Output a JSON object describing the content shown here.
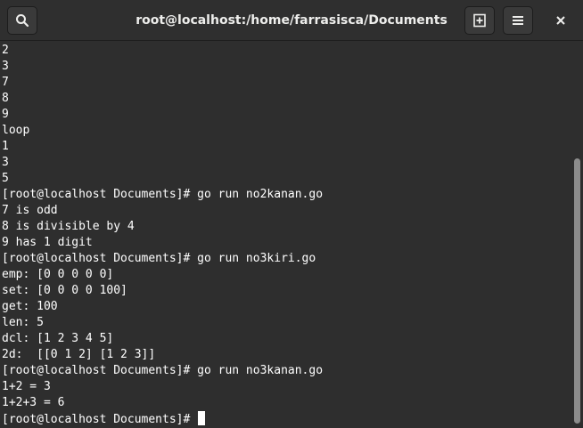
{
  "window": {
    "title": "root@localhost:/home/farrasisca/Documents"
  },
  "headerbar": {
    "search_icon": "search-icon",
    "new_tab_icon": "new-tab-icon",
    "menu_icon": "hamburger-menu-icon",
    "close_icon": "close-icon"
  },
  "terminal": {
    "lines": [
      "2",
      "3",
      "7",
      "8",
      "9",
      "loop",
      "1",
      "3",
      "5",
      "[root@localhost Documents]# go run no2kanan.go",
      "7 is odd",
      "8 is divisible by 4",
      "9 has 1 digit",
      "[root@localhost Documents]# go run no3kiri.go",
      "emp: [0 0 0 0 0]",
      "set: [0 0 0 0 100]",
      "get: 100",
      "len: 5",
      "dcl: [1 2 3 4 5]",
      "2d:  [[0 1 2] [1 2 3]]",
      "[root@localhost Documents]# go run no3kanan.go",
      "1+2 = 3",
      "1+2+3 = 6"
    ],
    "prompt": "[root@localhost Documents]# "
  },
  "colors": {
    "background": "#2e2e2e",
    "text": "#ffffff",
    "headerbar": "#2f2f2f"
  }
}
